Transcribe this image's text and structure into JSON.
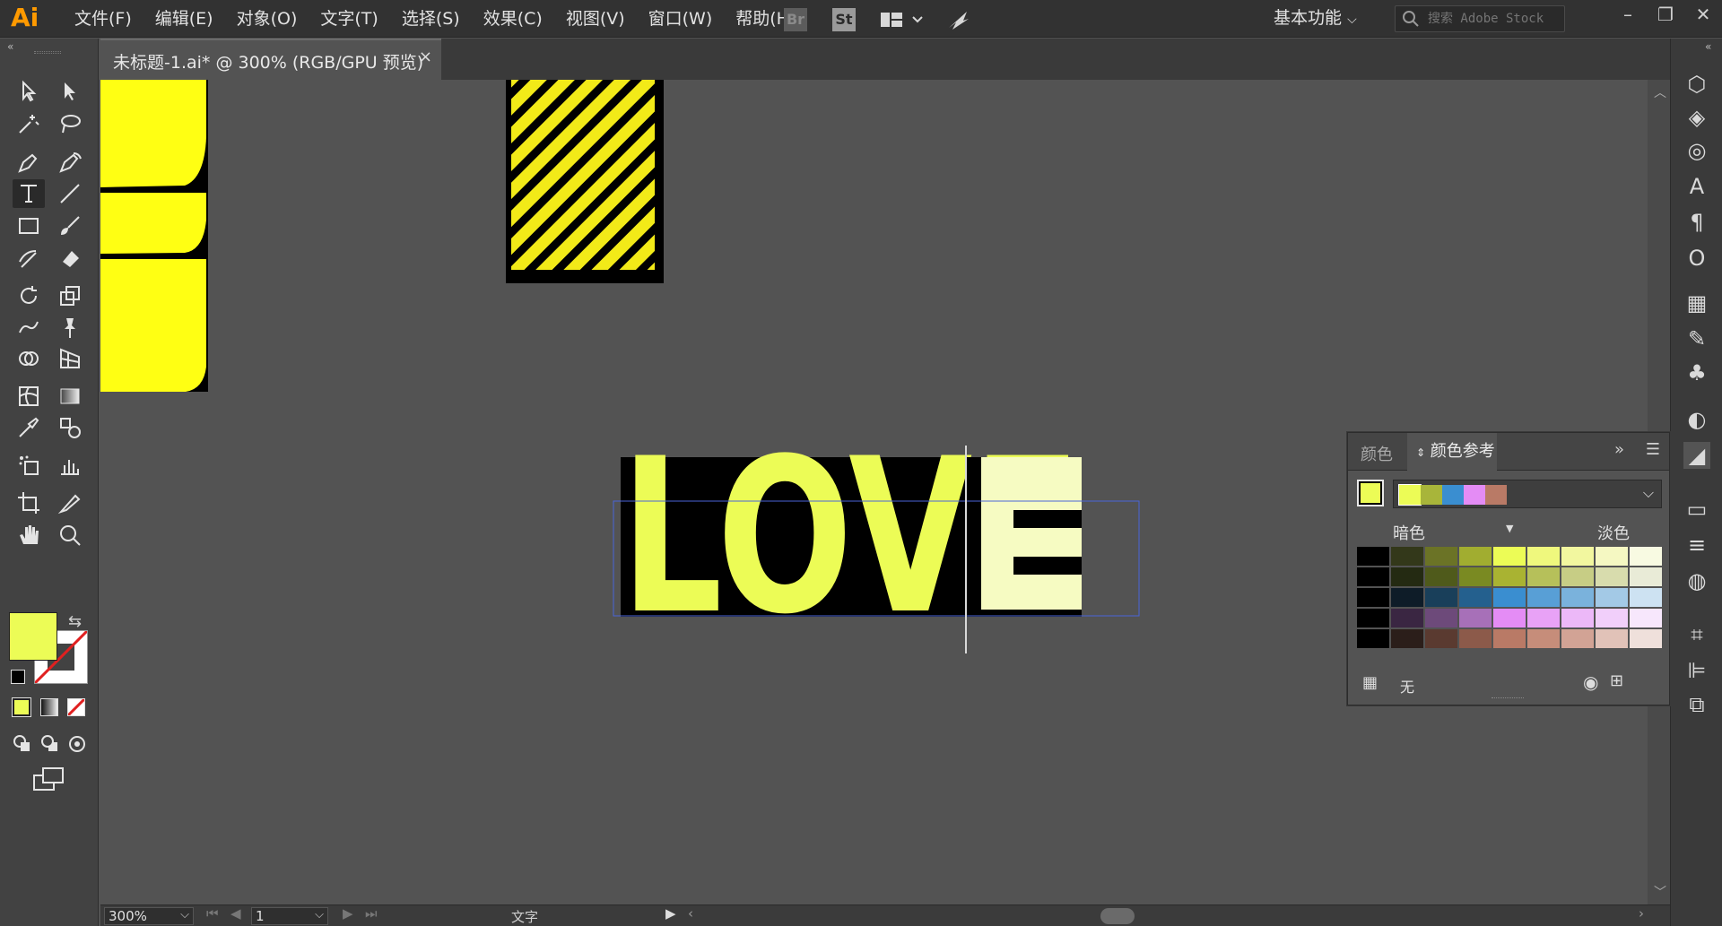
{
  "app": {
    "logo": "Ai"
  },
  "menu": [
    "文件(F)",
    "编辑(E)",
    "对象(O)",
    "文字(T)",
    "选择(S)",
    "效果(C)",
    "视图(V)",
    "窗口(W)",
    "帮助(H)"
  ],
  "topbar": {
    "br_label": "Br",
    "st_label": "St",
    "workspace": "基本功能",
    "search_placeholder": "搜索 Adobe Stock"
  },
  "document": {
    "tab_title": "未标题-1.ai* @ 300% (RGB/GPU 预览)",
    "close": "×",
    "love_text": "LOVE"
  },
  "status": {
    "zoom": "300%",
    "page": "1",
    "tool_name": "文字"
  },
  "fill_color": "#ecfc56",
  "color_panel": {
    "tab_color": "颜色",
    "tab_guide": "颜色参考",
    "dark_label": "暗色",
    "light_label": "淡色",
    "none_label": "无",
    "current_color": "#ecfc56",
    "harmony": [
      "#ecfc56",
      "#a8b53a",
      "#3a8ed0",
      "#e48cf5",
      "#b97a66"
    ],
    "grid": [
      [
        "#000000",
        "#33381a",
        "#6b7326",
        "#a1ad30",
        "#ecfc56",
        "#eff87d",
        "#f2f79f",
        "#f5f8c2",
        "#f8fae2"
      ],
      [
        "#000000",
        "#242a12",
        "#4f5a1b",
        "#7a8a22",
        "#a9b332",
        "#b6c05a",
        "#c7cd85",
        "#d8dcad",
        "#e9ebd7"
      ],
      [
        "#000000",
        "#0e1c28",
        "#193f5a",
        "#24608e",
        "#3a8ed0",
        "#589fd6",
        "#7ab2dc",
        "#a3c9e6",
        "#cde2f2"
      ],
      [
        "#000000",
        "#3a2642",
        "#6d4a7a",
        "#a770b8",
        "#e48cf5",
        "#e8a2f6",
        "#ecb8f8",
        "#f1cffa",
        "#f7e7fc"
      ],
      [
        "#000000",
        "#2b1e1a",
        "#5a3a30",
        "#8c5a4a",
        "#b97a66",
        "#c68d7a",
        "#d2a395",
        "#e1c2b8",
        "#efe0db"
      ]
    ]
  },
  "icons": {
    "zoom_dropdown": "chevron-down-icon"
  }
}
